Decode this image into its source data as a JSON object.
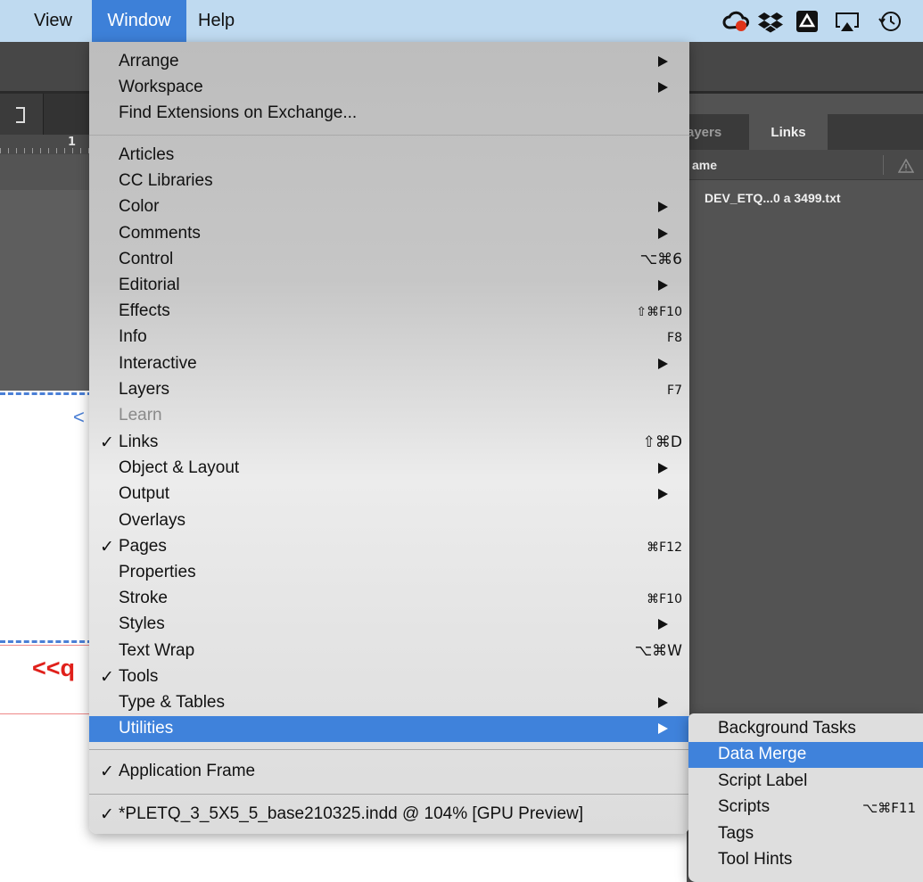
{
  "menubar": {
    "items": [
      "View",
      "Window",
      "Help"
    ],
    "tray_icons": [
      "creative-cloud-icon",
      "dropbox-icon",
      "google-drive-icon",
      "airplay-icon",
      "time-machine-icon"
    ]
  },
  "app": {
    "ruler_number": "1",
    "panel_tabs": {
      "layers": "ayers",
      "links": "Links"
    },
    "panel_header": "ame",
    "link_file": "DEV_ETQ...0 a 3499.txt",
    "page_glyph_lt": "<",
    "page_red_text": "<<q"
  },
  "window_menu": {
    "groups": [
      [
        {
          "label": "Arrange",
          "submenu": true
        },
        {
          "label": "Workspace",
          "submenu": true
        },
        {
          "label": "Find Extensions on Exchange..."
        }
      ],
      [
        {
          "label": "Articles"
        },
        {
          "label": "CC Libraries"
        },
        {
          "label": "Color",
          "submenu": true
        },
        {
          "label": "Comments",
          "submenu": true
        },
        {
          "label": "Control",
          "shortcut": "⌥⌘6"
        },
        {
          "label": "Editorial",
          "submenu": true
        },
        {
          "label": "Effects",
          "shortcut": "⇧⌘F10"
        },
        {
          "label": "Info",
          "shortcut": "F8"
        },
        {
          "label": "Interactive",
          "submenu": true
        },
        {
          "label": "Layers",
          "shortcut": "F7"
        },
        {
          "label": "Learn",
          "disabled": true
        },
        {
          "label": "Links",
          "checked": true,
          "shortcut": "⇧⌘D"
        },
        {
          "label": "Object & Layout",
          "submenu": true
        },
        {
          "label": "Output",
          "submenu": true
        },
        {
          "label": "Overlays"
        },
        {
          "label": "Pages",
          "checked": true,
          "shortcut": "⌘F12"
        },
        {
          "label": "Properties"
        },
        {
          "label": "Stroke",
          "shortcut": "⌘F10"
        },
        {
          "label": "Styles",
          "submenu": true
        },
        {
          "label": "Text Wrap",
          "shortcut": "⌥⌘W"
        },
        {
          "label": "Tools",
          "checked": true
        },
        {
          "label": "Type & Tables",
          "submenu": true
        },
        {
          "label": "Utilities",
          "submenu": true,
          "highlighted": true
        }
      ],
      [
        {
          "label": "Application Frame",
          "checked": true
        }
      ],
      [
        {
          "label": "*PLETQ_3_5X5_5_base210325.indd @ 104% [GPU Preview]",
          "checked": true
        }
      ]
    ]
  },
  "utilities_submenu": {
    "items": [
      {
        "label": "Background Tasks"
      },
      {
        "label": "Data Merge",
        "highlighted": true
      },
      {
        "label": "Script Label"
      },
      {
        "label": "Scripts",
        "shortcut": "⌥⌘F11"
      },
      {
        "label": "Tags"
      },
      {
        "label": "Tool Hints"
      }
    ]
  },
  "colors": {
    "menubar": "#bfdaf0",
    "highlight": "#3f82db",
    "panel": "#535353",
    "red_text": "#e0201a"
  }
}
